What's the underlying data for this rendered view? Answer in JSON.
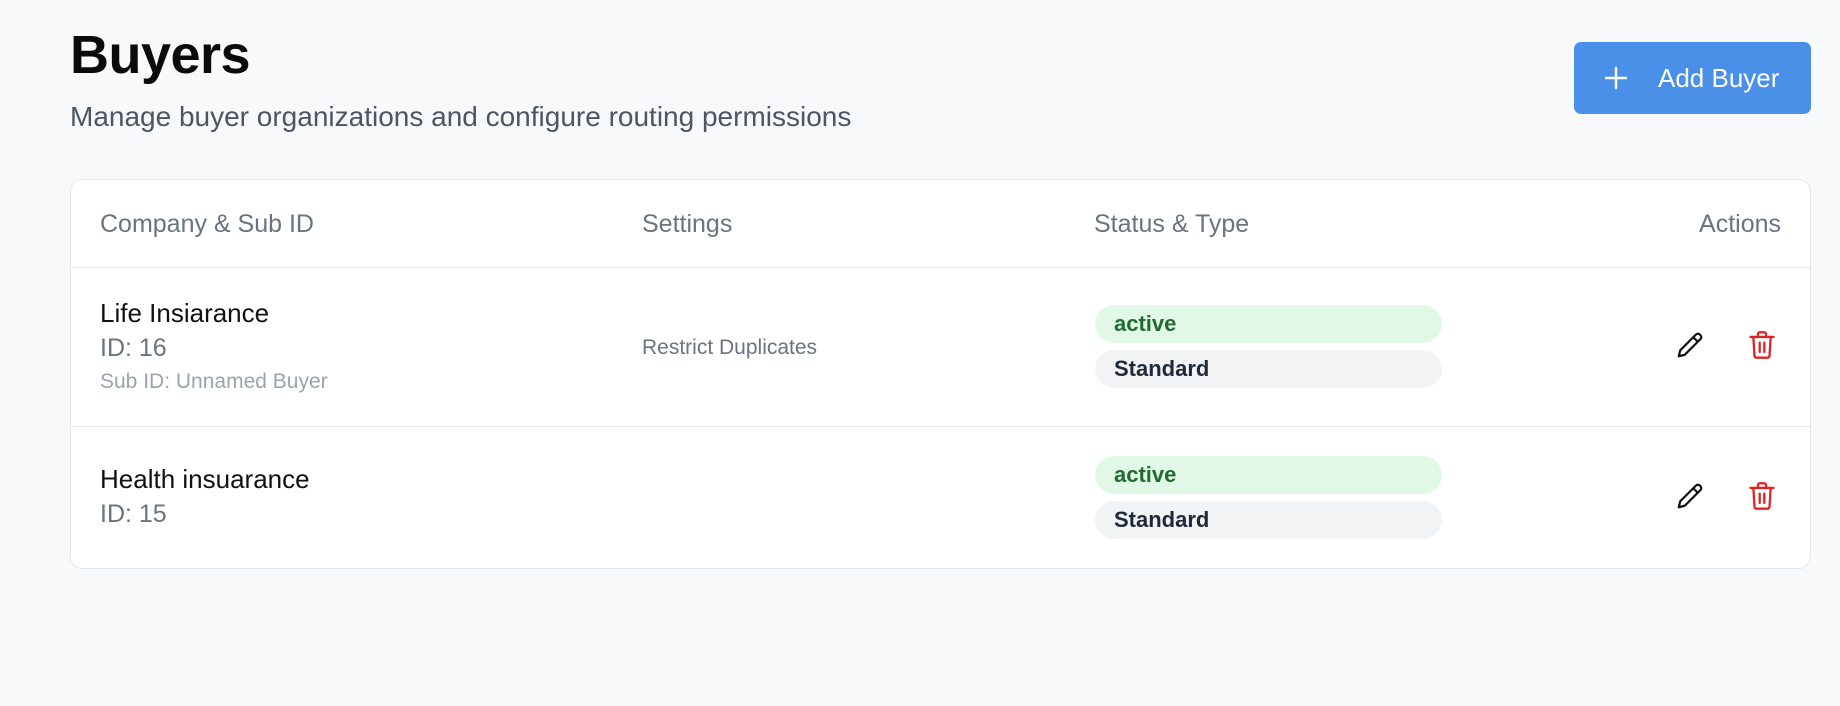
{
  "header": {
    "title": "Buyers",
    "subtitle": "Manage buyer organizations and configure routing permissions",
    "add_button_label": "Add Buyer",
    "add_button_icon": "plus-icon"
  },
  "table": {
    "columns": {
      "company": "Company & Sub ID",
      "settings": "Settings",
      "status": "Status & Type",
      "actions": "Actions"
    },
    "rows": [
      {
        "name": "Life Insiarance",
        "id": "ID: 16",
        "sub_id": "Sub ID: Unnamed Buyer",
        "settings": "Restrict Duplicates",
        "status": "active",
        "type": "Standard"
      },
      {
        "name": "Health insuarance",
        "id": "ID: 15",
        "status": "active",
        "type": "Standard"
      }
    ]
  },
  "icons": {
    "edit": "pencil-icon",
    "delete": "trash-icon"
  },
  "colors": {
    "accent": "#4a90e8",
    "delete": "#dc2626",
    "active_bg": "#e2f8e7",
    "active_text": "#1f6b33"
  }
}
